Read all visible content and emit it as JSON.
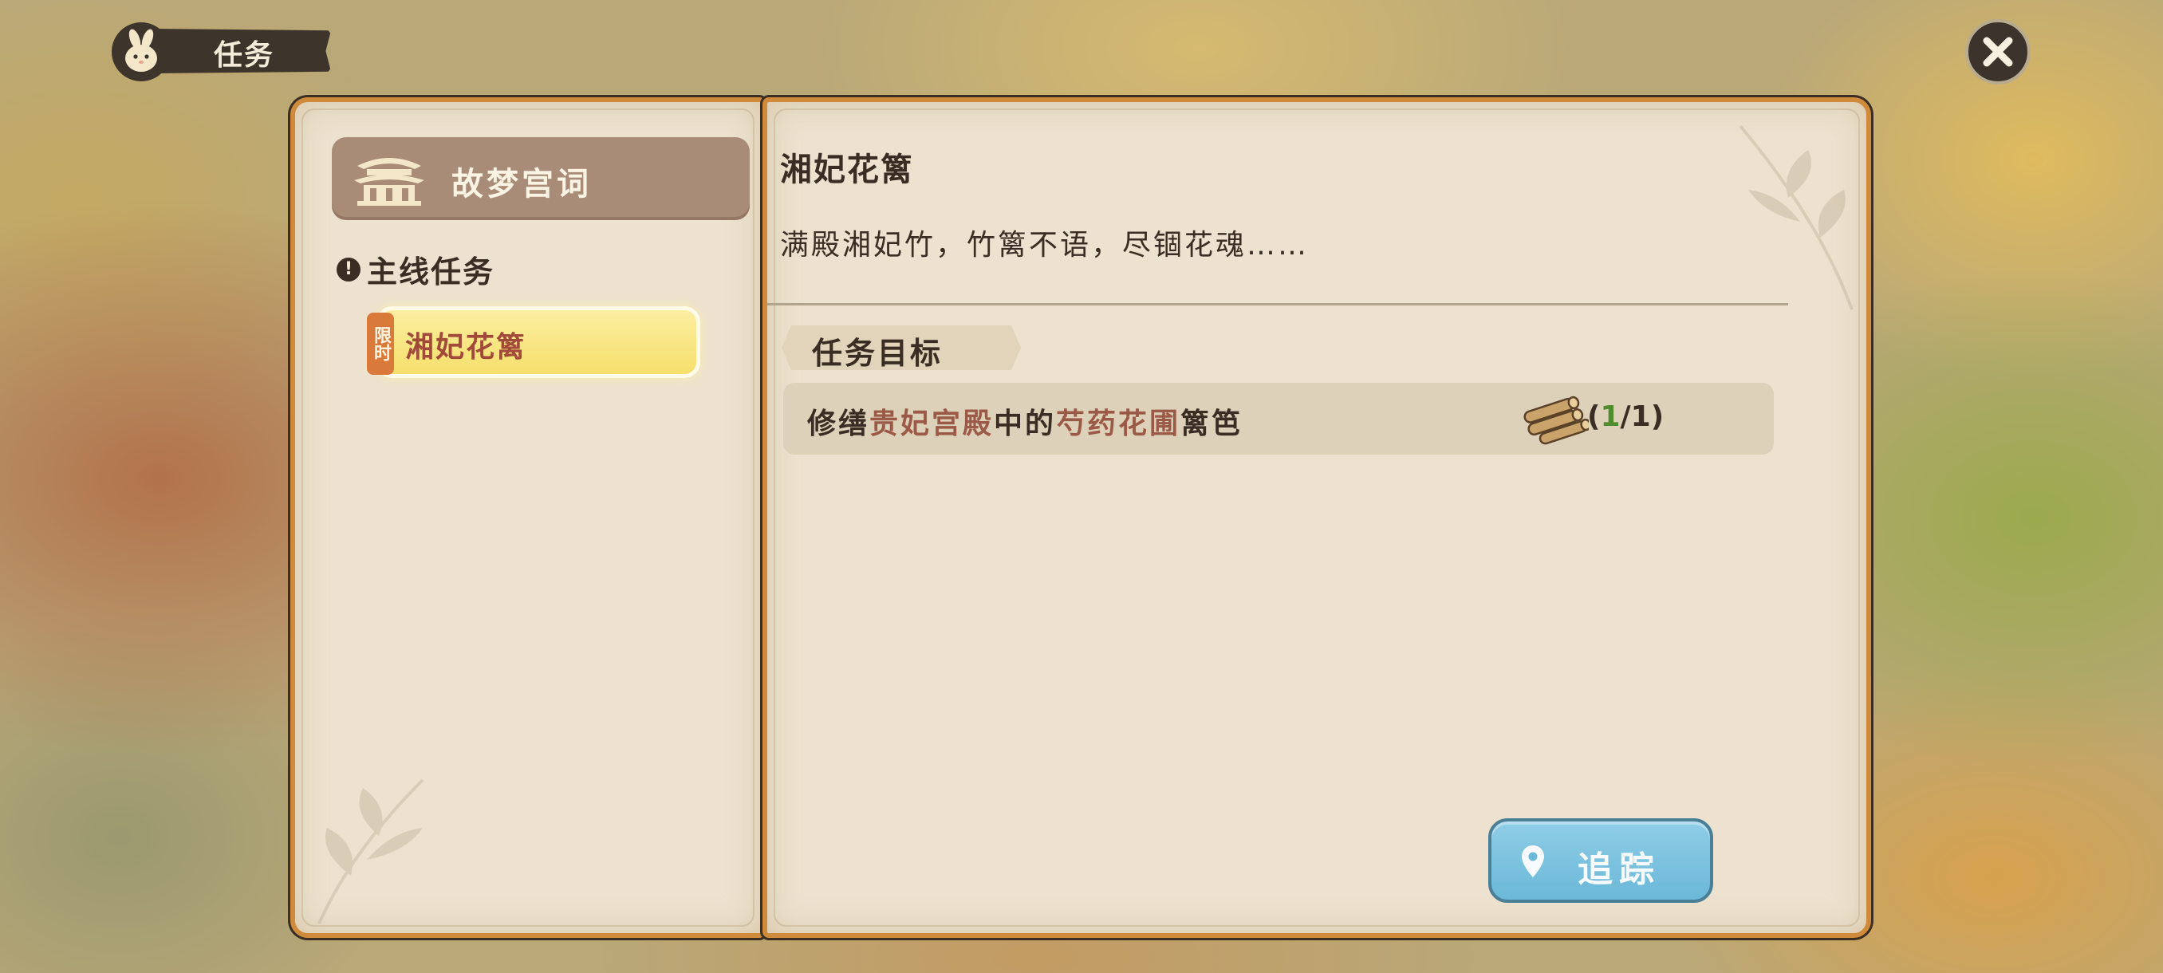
{
  "header": {
    "title": "任务",
    "icon": "rabbit-icon"
  },
  "close_button": {
    "icon": "close-icon"
  },
  "left_page": {
    "category": {
      "label": "故梦宫词",
      "icon": "palace-icon"
    },
    "section": {
      "label": "主线任务",
      "alert_symbol": "!"
    },
    "quest_list": [
      {
        "badge": "限时",
        "label": "湘妃花篱",
        "selected": true
      }
    ]
  },
  "right_page": {
    "quest_title": "湘妃花篱",
    "description": "满殿湘妃竹，竹篱不语，尽锢花魂……",
    "objectives_header": "任务目标",
    "objectives": [
      {
        "prefix": "修缮",
        "highlight1": "贵妃宫殿",
        "middle": "中的",
        "highlight2": "芍药花圃",
        "suffix": "篱笆",
        "item_icon": "wood-logs-icon",
        "progress_open": "(",
        "progress_current": "1",
        "progress_rest": "/1)"
      }
    ],
    "track_button": {
      "label": "追踪",
      "icon": "location-pin-icon"
    }
  },
  "colors": {
    "accent_orange": "#d08a3b",
    "paper": "#ece2cf",
    "text_dark": "#3a2e24",
    "highlight_text": "#9b5a47",
    "track_button": "#6bb8d8",
    "selected_item": "#f6df6c"
  }
}
